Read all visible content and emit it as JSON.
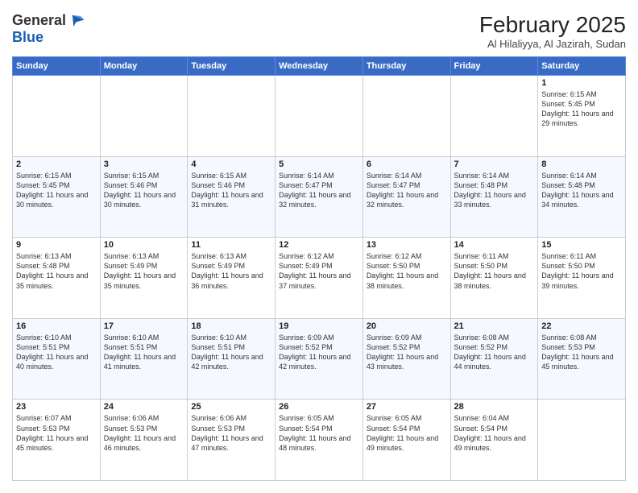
{
  "logo": {
    "line1": "General",
    "line2": "Blue"
  },
  "title": "February 2025",
  "subtitle": "Al Hilaliyya, Al Jazirah, Sudan",
  "headers": [
    "Sunday",
    "Monday",
    "Tuesday",
    "Wednesday",
    "Thursday",
    "Friday",
    "Saturday"
  ],
  "weeks": [
    [
      {
        "day": "",
        "info": ""
      },
      {
        "day": "",
        "info": ""
      },
      {
        "day": "",
        "info": ""
      },
      {
        "day": "",
        "info": ""
      },
      {
        "day": "",
        "info": ""
      },
      {
        "day": "",
        "info": ""
      },
      {
        "day": "1",
        "info": "Sunrise: 6:15 AM\nSunset: 5:45 PM\nDaylight: 11 hours and 29 minutes."
      }
    ],
    [
      {
        "day": "2",
        "info": "Sunrise: 6:15 AM\nSunset: 5:45 PM\nDaylight: 11 hours and 30 minutes."
      },
      {
        "day": "3",
        "info": "Sunrise: 6:15 AM\nSunset: 5:46 PM\nDaylight: 11 hours and 30 minutes."
      },
      {
        "day": "4",
        "info": "Sunrise: 6:15 AM\nSunset: 5:46 PM\nDaylight: 11 hours and 31 minutes."
      },
      {
        "day": "5",
        "info": "Sunrise: 6:14 AM\nSunset: 5:47 PM\nDaylight: 11 hours and 32 minutes."
      },
      {
        "day": "6",
        "info": "Sunrise: 6:14 AM\nSunset: 5:47 PM\nDaylight: 11 hours and 32 minutes."
      },
      {
        "day": "7",
        "info": "Sunrise: 6:14 AM\nSunset: 5:48 PM\nDaylight: 11 hours and 33 minutes."
      },
      {
        "day": "8",
        "info": "Sunrise: 6:14 AM\nSunset: 5:48 PM\nDaylight: 11 hours and 34 minutes."
      }
    ],
    [
      {
        "day": "9",
        "info": "Sunrise: 6:13 AM\nSunset: 5:48 PM\nDaylight: 11 hours and 35 minutes."
      },
      {
        "day": "10",
        "info": "Sunrise: 6:13 AM\nSunset: 5:49 PM\nDaylight: 11 hours and 35 minutes."
      },
      {
        "day": "11",
        "info": "Sunrise: 6:13 AM\nSunset: 5:49 PM\nDaylight: 11 hours and 36 minutes."
      },
      {
        "day": "12",
        "info": "Sunrise: 6:12 AM\nSunset: 5:49 PM\nDaylight: 11 hours and 37 minutes."
      },
      {
        "day": "13",
        "info": "Sunrise: 6:12 AM\nSunset: 5:50 PM\nDaylight: 11 hours and 38 minutes."
      },
      {
        "day": "14",
        "info": "Sunrise: 6:11 AM\nSunset: 5:50 PM\nDaylight: 11 hours and 38 minutes."
      },
      {
        "day": "15",
        "info": "Sunrise: 6:11 AM\nSunset: 5:50 PM\nDaylight: 11 hours and 39 minutes."
      }
    ],
    [
      {
        "day": "16",
        "info": "Sunrise: 6:10 AM\nSunset: 5:51 PM\nDaylight: 11 hours and 40 minutes."
      },
      {
        "day": "17",
        "info": "Sunrise: 6:10 AM\nSunset: 5:51 PM\nDaylight: 11 hours and 41 minutes."
      },
      {
        "day": "18",
        "info": "Sunrise: 6:10 AM\nSunset: 5:51 PM\nDaylight: 11 hours and 42 minutes."
      },
      {
        "day": "19",
        "info": "Sunrise: 6:09 AM\nSunset: 5:52 PM\nDaylight: 11 hours and 42 minutes."
      },
      {
        "day": "20",
        "info": "Sunrise: 6:09 AM\nSunset: 5:52 PM\nDaylight: 11 hours and 43 minutes."
      },
      {
        "day": "21",
        "info": "Sunrise: 6:08 AM\nSunset: 5:52 PM\nDaylight: 11 hours and 44 minutes."
      },
      {
        "day": "22",
        "info": "Sunrise: 6:08 AM\nSunset: 5:53 PM\nDaylight: 11 hours and 45 minutes."
      }
    ],
    [
      {
        "day": "23",
        "info": "Sunrise: 6:07 AM\nSunset: 5:53 PM\nDaylight: 11 hours and 45 minutes."
      },
      {
        "day": "24",
        "info": "Sunrise: 6:06 AM\nSunset: 5:53 PM\nDaylight: 11 hours and 46 minutes."
      },
      {
        "day": "25",
        "info": "Sunrise: 6:06 AM\nSunset: 5:53 PM\nDaylight: 11 hours and 47 minutes."
      },
      {
        "day": "26",
        "info": "Sunrise: 6:05 AM\nSunset: 5:54 PM\nDaylight: 11 hours and 48 minutes."
      },
      {
        "day": "27",
        "info": "Sunrise: 6:05 AM\nSunset: 5:54 PM\nDaylight: 11 hours and 49 minutes."
      },
      {
        "day": "28",
        "info": "Sunrise: 6:04 AM\nSunset: 5:54 PM\nDaylight: 11 hours and 49 minutes."
      },
      {
        "day": "",
        "info": ""
      }
    ]
  ]
}
